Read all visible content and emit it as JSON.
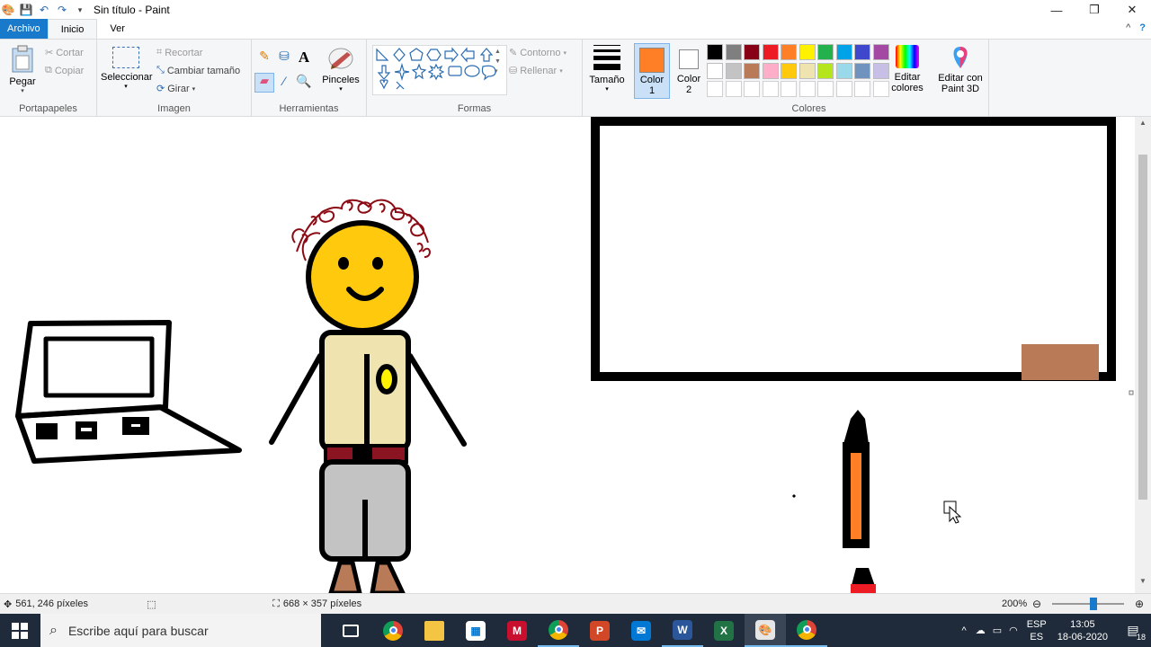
{
  "window": {
    "title": "Sin título - Paint",
    "controls": {
      "minimize": "—",
      "maximize": "❐",
      "close": "✕"
    }
  },
  "menu": {
    "tabs": [
      "Archivo",
      "Inicio",
      "Ver"
    ],
    "help_icon": "?",
    "collapse_icon": "^"
  },
  "ribbon": {
    "clipboard": {
      "paste": "Pegar",
      "cut": "Cortar",
      "copy": "Copiar",
      "label": "Portapapeles"
    },
    "image": {
      "select": "Seleccionar",
      "crop": "Recortar",
      "resize": "Cambiar tamaño",
      "rotate": "Girar",
      "label": "Imagen"
    },
    "tools": {
      "label": "Herramientas",
      "brushes": "Pinceles"
    },
    "shapes": {
      "outline": "Contorno",
      "fill": "Rellenar",
      "label": "Formas"
    },
    "size": {
      "label": "Tamaño"
    },
    "colors": {
      "color1_label": "Color 1",
      "color1_line1": "Color",
      "color1_line2": "1",
      "color2_line1": "Color",
      "color2_line2": "2",
      "color1": "#ff7f27",
      "color2": "#ffffff",
      "edit_line1": "Editar",
      "edit_line2": "colores",
      "paint3d_line1": "Editar con",
      "paint3d_line2": "Paint 3D",
      "label": "Colores",
      "palette_row1": [
        "#000000",
        "#7f7f7f",
        "#880015",
        "#ed1c24",
        "#ff7f27",
        "#fff200",
        "#22b14c",
        "#00a2e8",
        "#3f48cc",
        "#a349a4"
      ],
      "palette_row2": [
        "#ffffff",
        "#c3c3c3",
        "#b97a57",
        "#ffaec9",
        "#ffc90e",
        "#efe4b0",
        "#b5e61d",
        "#99d9ea",
        "#7092be",
        "#c8bfe7"
      ]
    }
  },
  "status": {
    "position": "561, 246 píxeles",
    "selection_size": "668 × 357 píxeles",
    "zoom": "200%"
  },
  "taskbar": {
    "search_placeholder": "Escribe aquí para buscar",
    "lang1": "ESP",
    "lang2": "ES",
    "time": "13:05",
    "date": "18-06-2020",
    "notifications": "18"
  }
}
